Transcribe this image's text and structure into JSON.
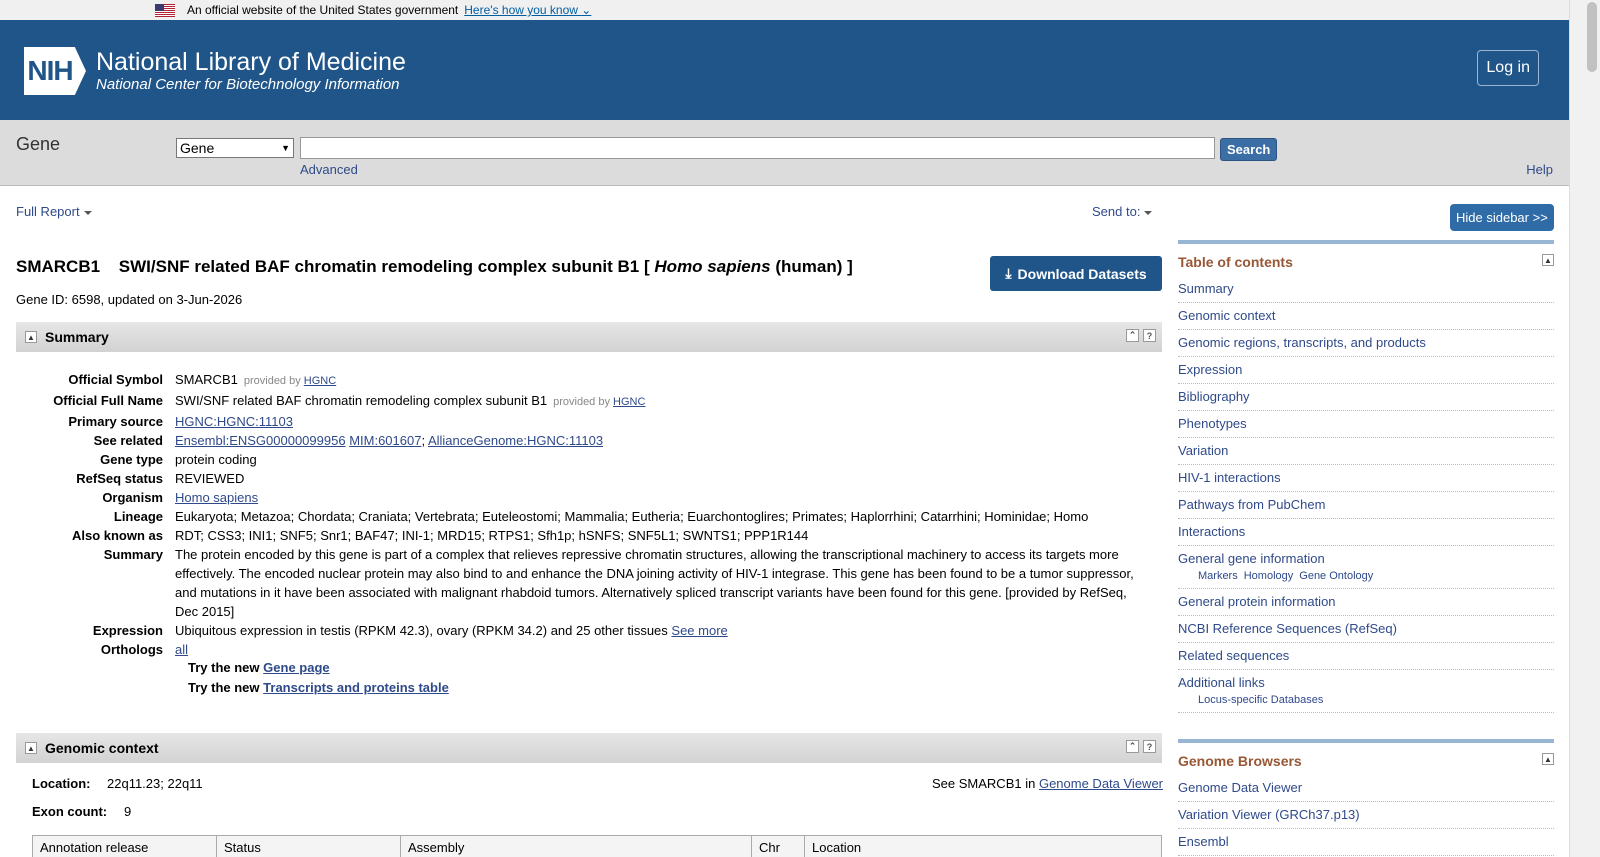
{
  "gov_banner": {
    "text": "An official website of the United States government",
    "link": "Here's how you know"
  },
  "header": {
    "logo_text": "NIH",
    "title": "National Library of Medicine",
    "subtitle": "National Center for Biotechnology Information",
    "login": "Log in"
  },
  "search": {
    "db_title": "Gene",
    "db_selected": "Gene",
    "query": "",
    "search_button": "Search",
    "advanced": "Advanced",
    "help": "Help"
  },
  "toolbar": {
    "full_report": "Full Report",
    "send_to": "Send to:",
    "hide_sidebar": "Hide sidebar >>"
  },
  "gene": {
    "symbol": "SMARCB1",
    "name": "SWI/SNF related BAF chromatin remodeling complex subunit B1",
    "bracket_open": "[",
    "species": "Homo sapiens",
    "common": "(human) ]",
    "gene_id_line": "Gene ID: 6598, updated on 3-Jun-2026",
    "download": "Download Datasets"
  },
  "summary_section": {
    "title": "Summary",
    "official_symbol_label": "Official Symbol",
    "official_symbol": "SMARCB1",
    "provided_by": "provided by",
    "hgnc": "HGNC",
    "official_full_name_label": "Official Full Name",
    "official_full_name": "SWI/SNF related BAF chromatin remodeling complex subunit B1",
    "primary_source_label": "Primary source",
    "primary_source": "HGNC:HGNC:11103",
    "see_related_label": "See related",
    "see_related_1": "Ensembl:ENSG00000099956",
    "see_related_2": "MIM:601607",
    "see_related_3": "AllianceGenome:HGNC:11103",
    "gene_type_label": "Gene type",
    "gene_type": "protein coding",
    "refseq_status_label": "RefSeq status",
    "refseq_status": "REVIEWED",
    "organism_label": "Organism",
    "organism": "Homo sapiens",
    "lineage_label": "Lineage",
    "lineage": "Eukaryota; Metazoa; Chordata; Craniata; Vertebrata; Euteleostomi; Mammalia; Eutheria; Euarchontoglires; Primates; Haplorrhini; Catarrhini; Hominidae; Homo",
    "aka_label": "Also known as",
    "aka": "RDT; CSS3; INI1; SNF5; Snr1; BAF47; INI-1; MRD15; RTPS1; Sfh1p; hSNFS; SNF5L1; SWNTS1; PPP1R144",
    "summary_label": "Summary",
    "summary": "The protein encoded by this gene is part of a complex that relieves repressive chromatin structures, allowing the transcriptional machinery to access its targets more effectively. The encoded nuclear protein may also bind to and enhance the DNA joining activity of HIV-1 integrase. This gene has been found to be a tumor suppressor, and mutations in it have been associated with malignant rhabdoid tumors. Alternatively spliced transcript variants have been found for this gene. [provided by RefSeq, Dec 2015]",
    "expression_label": "Expression",
    "expression": "Ubiquitous expression in testis (RPKM 42.3), ovary (RPKM 34.2) and 25 other tissues",
    "see_more": "See more",
    "orthologs_label": "Orthologs",
    "orthologs": "all",
    "try_new": "Try the new",
    "gene_page": "Gene page",
    "transcripts_table": "Transcripts and proteins table"
  },
  "genomic_section": {
    "title": "Genomic context",
    "location_label": "Location:",
    "location": "22q11.23; 22q11",
    "exon_label": "Exon count:",
    "exon_count": "9",
    "see_in": "See SMARCB1 in",
    "gdv": "Genome Data Viewer",
    "table_headers": [
      "Annotation release",
      "Status",
      "Assembly",
      "Chr",
      "Location"
    ]
  },
  "sidebar": {
    "toc_title": "Table of contents",
    "toc": [
      "Summary",
      "Genomic context",
      "Genomic regions, transcripts, and products",
      "Expression",
      "Bibliography",
      "Phenotypes",
      "Variation",
      "HIV-1 interactions",
      "Pathways from PubChem",
      "Interactions",
      "General gene information"
    ],
    "toc_sub1": [
      "Markers",
      "Homology",
      "Gene Ontology"
    ],
    "toc2": [
      "General protein information",
      "NCBI Reference Sequences (RefSeq)",
      "Related sequences",
      "Additional links"
    ],
    "toc_sub2": "Locus-specific Databases",
    "gb_title": "Genome Browsers",
    "gb": [
      "Genome Data Viewer",
      "Variation Viewer (GRCh37.p13)",
      "Ensembl"
    ]
  }
}
